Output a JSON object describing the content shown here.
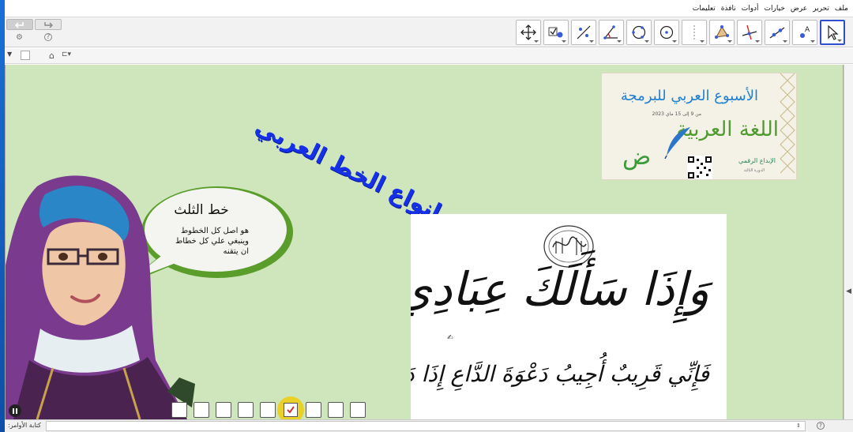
{
  "menu": [
    "ملف",
    "تحرير",
    "عرض",
    "خيارات",
    "أدوات",
    "نافذة",
    "تعليمات"
  ],
  "toolbar": {
    "undo_icon": "undo-icon",
    "redo_icon": "redo-icon",
    "settings_icon": "gear-icon",
    "help_icon": "help-icon",
    "tools": [
      {
        "name": "move-tool",
        "icon": "arrow-cursor-icon",
        "active": true
      },
      {
        "name": "point-tool",
        "icon": "point-a-icon"
      },
      {
        "name": "line-tool",
        "icon": "line-icon"
      },
      {
        "name": "perpendicular-tool",
        "icon": "perpendicular-icon"
      },
      {
        "name": "polygon-tool",
        "icon": "polygon-icon"
      },
      {
        "name": "slider-tool",
        "icon": "slider-icon"
      },
      {
        "name": "circle-tool",
        "icon": "circle-icon"
      },
      {
        "name": "circle-three-points-tool",
        "icon": "circle-points-icon"
      },
      {
        "name": "angle-tool",
        "icon": "angle-icon"
      },
      {
        "name": "reflect-tool",
        "icon": "reflect-icon"
      },
      {
        "name": "checkbox-tool",
        "icon": "checkbox-icon"
      },
      {
        "name": "move-graphics-tool",
        "icon": "move-arrows-icon"
      }
    ]
  },
  "viewbar": {
    "home_icon": "home-icon",
    "graphics_icon": "graphics-view-icon"
  },
  "canvas": {
    "background": "#cfe6bc",
    "heading": "انواع الخط العربي",
    "poster": {
      "title": "الأسبوع العربي للبرمجة",
      "date": "من 9 إلى 15 ماي 2023",
      "main": "اللغة العربية",
      "subtitle": "الإبداع الرقمي",
      "edition": "الدورة الثالثة",
      "letter": "ض"
    },
    "bubble": {
      "title": "خط الثلث",
      "text": "هو اصل كل الخطوط\nوينبغي علي كل خطاط\nان يتقنه"
    },
    "calligraphy": {
      "main": "وَإِذَا سَأَلَكَ عِبَادِي عَنِّي",
      "sub": "فَإِنِّي قَرِيبٌ أُجِيبُ دَعْوَةَ الدَّاعِ إِذَا دَعَانِ",
      "seal": "الله"
    },
    "slides": {
      "count": 9,
      "current": 6
    },
    "pause_icon": "pause-icon"
  },
  "input_bar": {
    "label": "كتابة الأوامر:",
    "value": "",
    "help_icon": "help-icon"
  }
}
